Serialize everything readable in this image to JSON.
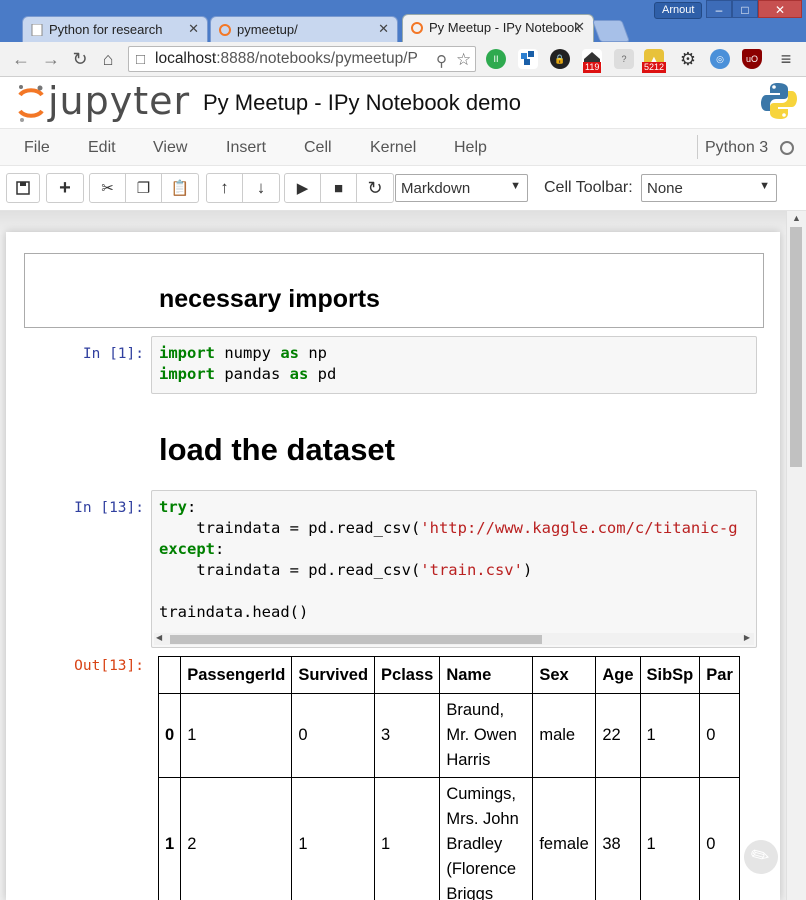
{
  "browser": {
    "tabs": [
      {
        "title": "Python for research",
        "active": false
      },
      {
        "title": "pymeetup/",
        "active": false
      },
      {
        "title": "Py Meetup - IPy Notebook",
        "active": true
      }
    ],
    "user": "Arnout",
    "url_host": "localhost",
    "url_path": ":8888/notebooks/pymeetup/P",
    "ext_badges": {
      "mail": "119",
      "counter": "5212"
    }
  },
  "jupyter": {
    "logo_text": "jupyter",
    "notebook_name": "Py Meetup - IPy Notebook demo",
    "menu": [
      "File",
      "Edit",
      "View",
      "Insert",
      "Cell",
      "Kernel",
      "Help"
    ],
    "kernel": "Python 3",
    "cell_type": "Markdown",
    "cell_toolbar_label": "Cell Toolbar:",
    "cell_toolbar_value": "None"
  },
  "cells": {
    "md1": "necessary imports",
    "in1_prompt": "In [1]:",
    "md2": "load the dataset",
    "in13_prompt": "In [13]:",
    "out13_prompt": "Out[13]:"
  },
  "table": {
    "columns": [
      "",
      "PassengerId",
      "Survived",
      "Pclass",
      "Name",
      "Sex",
      "Age",
      "SibSp",
      "Par"
    ],
    "rows": [
      [
        "0",
        "1",
        "0",
        "3",
        "Braund, Mr. Owen Harris",
        "male",
        "22",
        "1",
        "0"
      ],
      [
        "1",
        "2",
        "1",
        "1",
        "Cumings, Mrs. John Bradley (Florence Briggs",
        "female",
        "38",
        "1",
        "0"
      ]
    ]
  }
}
